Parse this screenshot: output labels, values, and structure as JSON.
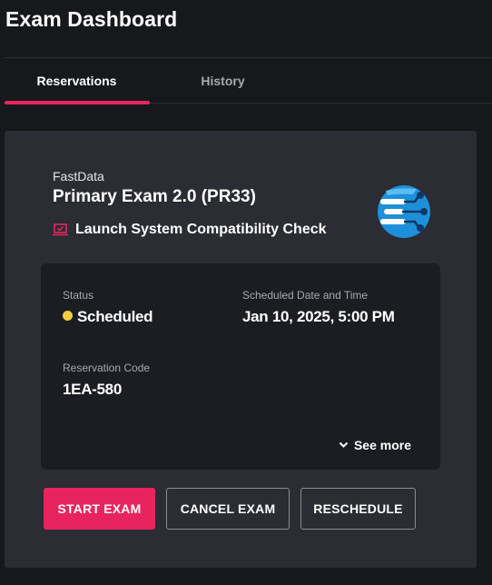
{
  "header": {
    "title": "Exam Dashboard"
  },
  "tabs": [
    {
      "label": "Reservations",
      "active": true
    },
    {
      "label": "History",
      "active": false
    }
  ],
  "exam": {
    "vendor": "FastData",
    "name": "Primary Exam 2.0 (PR33)",
    "compat_link": "Launch System Compatibility Check",
    "logo_icon": "fastdata-logo-icon"
  },
  "details": {
    "status_label": "Status",
    "status_value": "Scheduled",
    "status_color": "#f2cf3c",
    "datetime_label": "Scheduled Date and Time",
    "datetime_value": "Jan 10, 2025, 5:00 PM",
    "code_label": "Reservation Code",
    "code_value": "1EA-580",
    "see_more": "See more"
  },
  "actions": {
    "start": "START EXAM",
    "cancel": "CANCEL EXAM",
    "reschedule": "RESCHEDULE"
  },
  "colors": {
    "accent": "#e8245f",
    "background": "#17181b",
    "card": "#2b2c34",
    "panel": "#1c1d22"
  }
}
